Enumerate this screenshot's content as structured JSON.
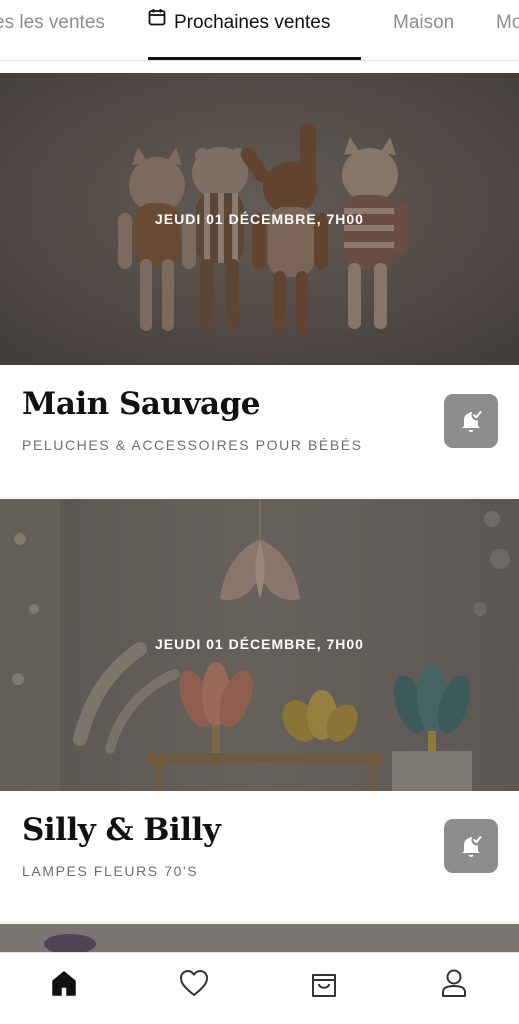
{
  "tabs": [
    {
      "label": "Toutes les ventes",
      "visible": "es les ventes",
      "active": false
    },
    {
      "label": "Prochaines ventes",
      "active": true,
      "icon": "calendar-icon"
    },
    {
      "label": "Maison",
      "active": false
    },
    {
      "label": "Mode",
      "visible": "Mo",
      "active": false
    }
  ],
  "sales": [
    {
      "date": "JEUDI 01 DÉCEMBRE, 7H00",
      "brand": "Main Sauvage",
      "subtitle": "PELUCHES & ACCESSOIRES POUR BÉBÉS",
      "image": "knitted-plush-toys-photo",
      "action_icon": "bell-check-icon"
    },
    {
      "date": "JEUDI 01 DÉCEMBRE, 7H00",
      "brand": "Silly & Billy",
      "subtitle": "LAMPES FLEURS 70'S",
      "image": "flower-lamps-photo",
      "action_icon": "bell-check-icon"
    }
  ],
  "bottom_nav": [
    {
      "icon": "home-icon",
      "active": true
    },
    {
      "icon": "heart-icon",
      "active": false
    },
    {
      "icon": "shopping-bag-icon",
      "active": false
    },
    {
      "icon": "profile-icon",
      "active": false
    }
  ],
  "colors": {
    "active_text": "#111111",
    "inactive_text": "#8e8e8e",
    "bell_button": "#8d8d8d",
    "subtitle": "#6f6f6f"
  }
}
